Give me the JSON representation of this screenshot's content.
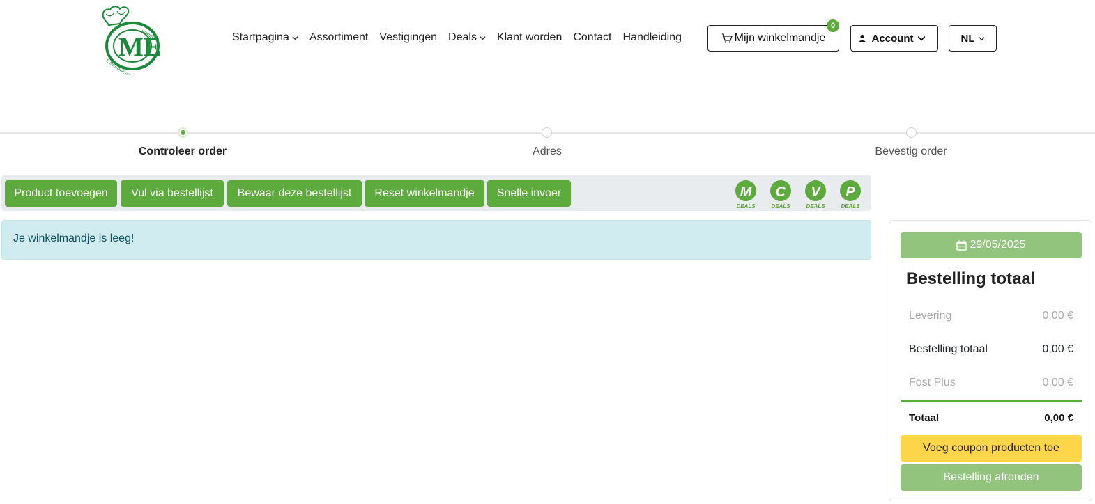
{
  "brand": {
    "logo_text": "ME",
    "logo_ring_text": "HORECA E. MEEUWISSEN",
    "color": "#1a8a3a"
  },
  "nav": {
    "items": [
      {
        "label": "Startpagina",
        "dropdown": true
      },
      {
        "label": "Assortiment",
        "dropdown": false
      },
      {
        "label": "Vestigingen",
        "dropdown": false
      },
      {
        "label": "Deals",
        "dropdown": true
      },
      {
        "label": "Klant worden",
        "dropdown": false
      },
      {
        "label": "Contact",
        "dropdown": false
      },
      {
        "label": "Handleiding",
        "dropdown": false
      }
    ]
  },
  "header": {
    "cart_label": "Mijn winkelmandje",
    "cart_count": "0",
    "account_label": "Account",
    "language": "NL"
  },
  "stepper": {
    "steps": [
      {
        "label": "Controleer order",
        "active": true
      },
      {
        "label": "Adres",
        "active": false
      },
      {
        "label": "Bevestig order",
        "active": false
      }
    ]
  },
  "toolbar": {
    "buttons": [
      "Product toevoegen",
      "Vul via bestellijst",
      "Bewaar deze bestellijst",
      "Reset winkelmandje",
      "Snelle invoer"
    ],
    "deals": [
      {
        "letter": "M",
        "caption": "DEALS"
      },
      {
        "letter": "C",
        "caption": "DEALS"
      },
      {
        "letter": "V",
        "caption": "DEALS"
      },
      {
        "letter": "P",
        "caption": "DEALS"
      }
    ]
  },
  "cart": {
    "empty_message": "Je winkelmandje is leeg!"
  },
  "summary": {
    "date": "29/05/2025",
    "title": "Bestelling totaal",
    "rows": [
      {
        "label": "Levering",
        "value": "0,00 €"
      },
      {
        "label": "Bestelling totaal",
        "value": "0,00 €"
      },
      {
        "label": "Fost Plus",
        "value": "0,00 €"
      }
    ],
    "total_label": "Totaal",
    "total_value": "0,00 €",
    "coupon_button": "Voeg coupon producten toe",
    "finish_button": "Bestelling afronden"
  },
  "colors": {
    "primary": "#5daa3d",
    "muted_green": "#93c47d",
    "coupon": "#ffd54a",
    "info_bg": "#d1ecf1",
    "info_text": "#0c5460"
  }
}
